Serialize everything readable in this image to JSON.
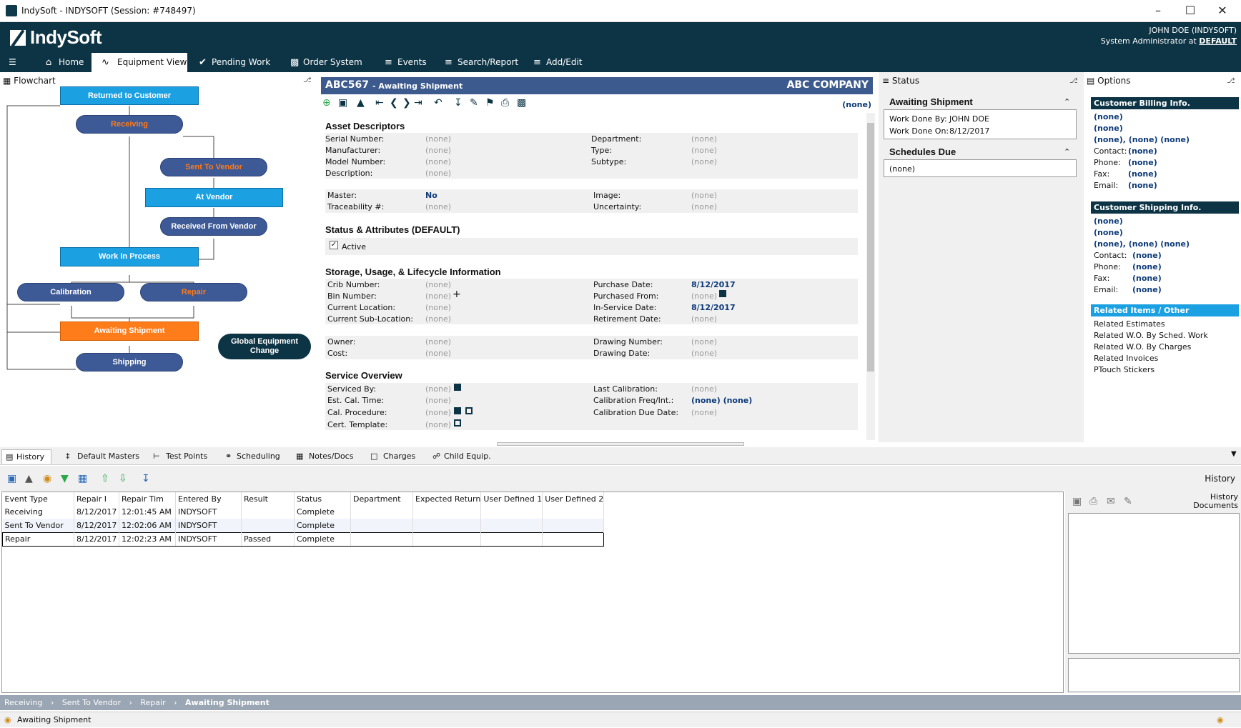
{
  "window": {
    "title": "IndySoft - INDYSOFT (Session: #748497)"
  },
  "header": {
    "logo": "IndySoft",
    "user": "JOHN DOE (INDYSOFT)",
    "role": "System Administrator at",
    "site": "DEFAULT"
  },
  "nav": {
    "home": "Home",
    "equipment": "Equipment View",
    "pending": "Pending Work",
    "order": "Order System",
    "events": "Events",
    "search": "Search/Report",
    "addedit": "Add/Edit"
  },
  "flowchart": {
    "title": "Flowchart",
    "nodes": {
      "returned": "Returned to Customer",
      "receiving": "Receiving",
      "sent_vendor": "Sent To Vendor",
      "at_vendor": "At Vendor",
      "received_vendor": "Received From Vendor",
      "wip": "Work In Process",
      "calibration": "Calibration",
      "repair": "Repair",
      "awaiting": "Awaiting Shipment",
      "shipping": "Shipping",
      "global": "Global Equipment Change"
    }
  },
  "record": {
    "id": "ABC567",
    "status": "- Awaiting Shipment",
    "company": "ABC COMPANY",
    "none_right": "(none)"
  },
  "asset": {
    "title": "Asset Descriptors",
    "serial_l": "Serial Number:",
    "serial_v": "(none)",
    "manuf_l": "Manufacturer:",
    "manuf_v": "(none)",
    "model_l": "Model Number:",
    "model_v": "(none)",
    "desc_l": "Description:",
    "desc_v": "(none)",
    "dept_l": "Department:",
    "dept_v": "(none)",
    "type_l": "Type:",
    "type_v": "(none)",
    "subtype_l": "Subtype:",
    "subtype_v": "(none)",
    "master_l": "Master:",
    "master_v": "No",
    "trace_l": "Traceability #:",
    "trace_v": "(none)",
    "image_l": "Image:",
    "image_v": "(none)",
    "unc_l": "Uncertainty:",
    "unc_v": "(none)"
  },
  "attrs": {
    "title": "Status & Attributes (DEFAULT)",
    "active": "Active"
  },
  "storage": {
    "title": "Storage, Usage, & Lifecycle Information",
    "crib_l": "Crib Number:",
    "crib_v": "(none)",
    "bin_l": "Bin Number:",
    "bin_v": "(none)",
    "loc_l": "Current Location:",
    "loc_v": "(none)",
    "subloc_l": "Current Sub-Location:",
    "subloc_v": "(none)",
    "pdate_l": "Purchase Date:",
    "pdate_v": "8/12/2017",
    "pfrom_l": "Purchased From:",
    "pfrom_v": "(none)",
    "isdate_l": "In-Service Date:",
    "isdate_v": "8/12/2017",
    "ret_l": "Retirement Date:",
    "ret_v": "(none)",
    "owner_l": "Owner:",
    "owner_v": "(none)",
    "cost_l": "Cost:",
    "cost_v": "(none)",
    "dnum_l": "Drawing Number:",
    "dnum_v": "(none)",
    "ddate_l": "Drawing Date:",
    "ddate_v": "(none)"
  },
  "service": {
    "title": "Service Overview",
    "sby_l": "Serviced By:",
    "sby_v": "(none)",
    "ect_l": "Est. Cal. Time:",
    "ect_v": "(none)",
    "proc_l": "Cal. Procedure:",
    "proc_v": "(none)",
    "cert_l": "Cert. Template:",
    "cert_v": "(none)",
    "last_l": "Last Calibration:",
    "last_v": "(none)",
    "freq_l": "Calibration Freq/Int.:",
    "freq_v": "(none) (none)",
    "due_l": "Calibration Due Date:",
    "due_v": "(none)"
  },
  "status_panel": {
    "title": "Status",
    "section1": "Awaiting Shipment",
    "by_l": "Work Done By:",
    "by_v": "JOHN DOE",
    "on_l": "Work Done On:",
    "on_v": "8/12/2017",
    "section2": "Schedules Due",
    "sched_v": "(none)"
  },
  "options": {
    "title": "Options",
    "billing": "Customer Billing Info.",
    "shipping": "Customer Shipping Info.",
    "none": "(none)",
    "none3": "(none), (none)  (none)",
    "contact": "Contact:",
    "phone": "Phone:",
    "fax": "Fax:",
    "email": "Email:",
    "related": "Related Items / Other",
    "links": [
      "Related Estimates",
      "Related W.O. By Sched. Work",
      "Related W.O. By Charges",
      "Related Invoices",
      "PTouch Stickers"
    ]
  },
  "bottom_tabs": {
    "history": "History",
    "masters": "Default Masters",
    "points": "Test Points",
    "sched": "Scheduling",
    "notes": "Notes/Docs",
    "charges": "Charges",
    "child": "Child Equip."
  },
  "history": {
    "title": "History",
    "docs_title": "History\nDocuments",
    "columns": [
      "Event Type",
      "Repair I",
      "Repair Tim",
      "Entered By",
      "Result",
      "Status",
      "Department",
      "Expected Return",
      "User Defined 1",
      "User Defined 2"
    ],
    "rows": [
      [
        "Receiving",
        "8/12/2017",
        "12:01:45 AM",
        "INDYSOFT",
        "",
        "Complete",
        "",
        "",
        "",
        ""
      ],
      [
        "Sent To Vendor",
        "8/12/2017",
        "12:02:06 AM",
        "INDYSOFT",
        "",
        "Complete",
        "",
        "",
        "",
        ""
      ],
      [
        "Repair",
        "8/12/2017",
        "12:02:23 AM",
        "INDYSOFT",
        "Passed",
        "Complete",
        "",
        "",
        "",
        ""
      ]
    ]
  },
  "breadcrumb": [
    "Receiving",
    "Sent To Vendor",
    "Repair",
    "Awaiting Shipment"
  ],
  "statusbar": {
    "text": "Awaiting Shipment"
  }
}
